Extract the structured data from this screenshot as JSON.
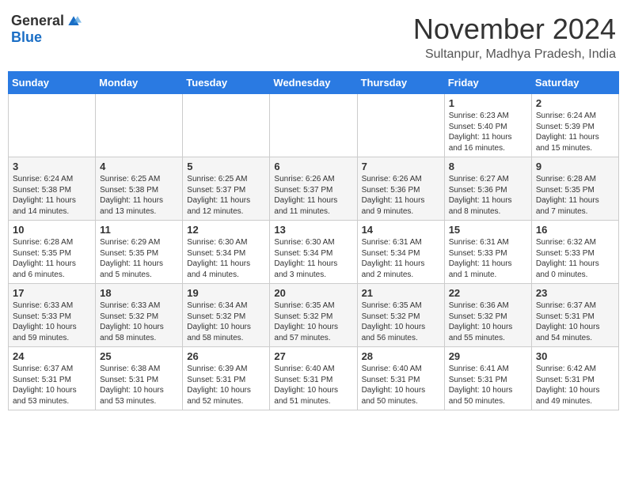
{
  "logo": {
    "general": "General",
    "blue": "Blue"
  },
  "title": "November 2024",
  "location": "Sultanpur, Madhya Pradesh, India",
  "days_of_week": [
    "Sunday",
    "Monday",
    "Tuesday",
    "Wednesday",
    "Thursday",
    "Friday",
    "Saturday"
  ],
  "weeks": [
    [
      {
        "day": "",
        "info": ""
      },
      {
        "day": "",
        "info": ""
      },
      {
        "day": "",
        "info": ""
      },
      {
        "day": "",
        "info": ""
      },
      {
        "day": "",
        "info": ""
      },
      {
        "day": "1",
        "info": "Sunrise: 6:23 AM\nSunset: 5:40 PM\nDaylight: 11 hours and 16 minutes."
      },
      {
        "day": "2",
        "info": "Sunrise: 6:24 AM\nSunset: 5:39 PM\nDaylight: 11 hours and 15 minutes."
      }
    ],
    [
      {
        "day": "3",
        "info": "Sunrise: 6:24 AM\nSunset: 5:38 PM\nDaylight: 11 hours and 14 minutes."
      },
      {
        "day": "4",
        "info": "Sunrise: 6:25 AM\nSunset: 5:38 PM\nDaylight: 11 hours and 13 minutes."
      },
      {
        "day": "5",
        "info": "Sunrise: 6:25 AM\nSunset: 5:37 PM\nDaylight: 11 hours and 12 minutes."
      },
      {
        "day": "6",
        "info": "Sunrise: 6:26 AM\nSunset: 5:37 PM\nDaylight: 11 hours and 11 minutes."
      },
      {
        "day": "7",
        "info": "Sunrise: 6:26 AM\nSunset: 5:36 PM\nDaylight: 11 hours and 9 minutes."
      },
      {
        "day": "8",
        "info": "Sunrise: 6:27 AM\nSunset: 5:36 PM\nDaylight: 11 hours and 8 minutes."
      },
      {
        "day": "9",
        "info": "Sunrise: 6:28 AM\nSunset: 5:35 PM\nDaylight: 11 hours and 7 minutes."
      }
    ],
    [
      {
        "day": "10",
        "info": "Sunrise: 6:28 AM\nSunset: 5:35 PM\nDaylight: 11 hours and 6 minutes."
      },
      {
        "day": "11",
        "info": "Sunrise: 6:29 AM\nSunset: 5:35 PM\nDaylight: 11 hours and 5 minutes."
      },
      {
        "day": "12",
        "info": "Sunrise: 6:30 AM\nSunset: 5:34 PM\nDaylight: 11 hours and 4 minutes."
      },
      {
        "day": "13",
        "info": "Sunrise: 6:30 AM\nSunset: 5:34 PM\nDaylight: 11 hours and 3 minutes."
      },
      {
        "day": "14",
        "info": "Sunrise: 6:31 AM\nSunset: 5:34 PM\nDaylight: 11 hours and 2 minutes."
      },
      {
        "day": "15",
        "info": "Sunrise: 6:31 AM\nSunset: 5:33 PM\nDaylight: 11 hours and 1 minute."
      },
      {
        "day": "16",
        "info": "Sunrise: 6:32 AM\nSunset: 5:33 PM\nDaylight: 11 hours and 0 minutes."
      }
    ],
    [
      {
        "day": "17",
        "info": "Sunrise: 6:33 AM\nSunset: 5:33 PM\nDaylight: 10 hours and 59 minutes."
      },
      {
        "day": "18",
        "info": "Sunrise: 6:33 AM\nSunset: 5:32 PM\nDaylight: 10 hours and 58 minutes."
      },
      {
        "day": "19",
        "info": "Sunrise: 6:34 AM\nSunset: 5:32 PM\nDaylight: 10 hours and 58 minutes."
      },
      {
        "day": "20",
        "info": "Sunrise: 6:35 AM\nSunset: 5:32 PM\nDaylight: 10 hours and 57 minutes."
      },
      {
        "day": "21",
        "info": "Sunrise: 6:35 AM\nSunset: 5:32 PM\nDaylight: 10 hours and 56 minutes."
      },
      {
        "day": "22",
        "info": "Sunrise: 6:36 AM\nSunset: 5:32 PM\nDaylight: 10 hours and 55 minutes."
      },
      {
        "day": "23",
        "info": "Sunrise: 6:37 AM\nSunset: 5:31 PM\nDaylight: 10 hours and 54 minutes."
      }
    ],
    [
      {
        "day": "24",
        "info": "Sunrise: 6:37 AM\nSunset: 5:31 PM\nDaylight: 10 hours and 53 minutes."
      },
      {
        "day": "25",
        "info": "Sunrise: 6:38 AM\nSunset: 5:31 PM\nDaylight: 10 hours and 53 minutes."
      },
      {
        "day": "26",
        "info": "Sunrise: 6:39 AM\nSunset: 5:31 PM\nDaylight: 10 hours and 52 minutes."
      },
      {
        "day": "27",
        "info": "Sunrise: 6:40 AM\nSunset: 5:31 PM\nDaylight: 10 hours and 51 minutes."
      },
      {
        "day": "28",
        "info": "Sunrise: 6:40 AM\nSunset: 5:31 PM\nDaylight: 10 hours and 50 minutes."
      },
      {
        "day": "29",
        "info": "Sunrise: 6:41 AM\nSunset: 5:31 PM\nDaylight: 10 hours and 50 minutes."
      },
      {
        "day": "30",
        "info": "Sunrise: 6:42 AM\nSunset: 5:31 PM\nDaylight: 10 hours and 49 minutes."
      }
    ]
  ]
}
